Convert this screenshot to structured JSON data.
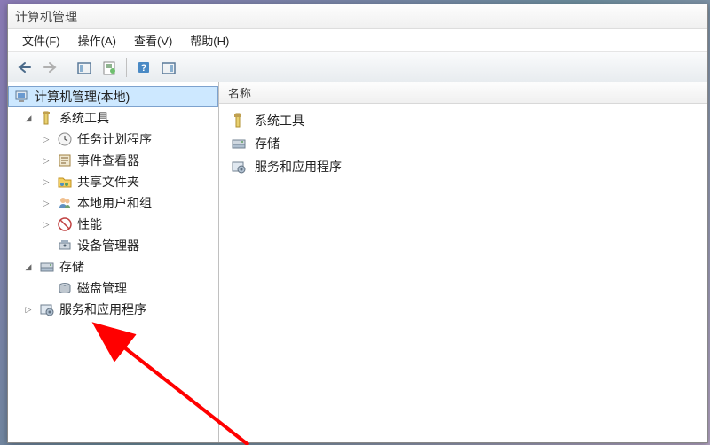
{
  "window": {
    "title": "计算机管理"
  },
  "menu": {
    "file": "文件(F)",
    "action": "操作(A)",
    "view": "查看(V)",
    "help": "帮助(H)"
  },
  "tree": {
    "root": "计算机管理(本地)",
    "system_tools": "系统工具",
    "task_scheduler": "任务计划程序",
    "event_viewer": "事件查看器",
    "shared_folders": "共享文件夹",
    "local_users": "本地用户和组",
    "performance": "性能",
    "device_manager": "设备管理器",
    "storage": "存储",
    "disk_management": "磁盘管理",
    "services_apps": "服务和应用程序"
  },
  "list": {
    "header_name": "名称",
    "items": {
      "system_tools": "系统工具",
      "storage": "存储",
      "services_apps": "服务和应用程序"
    }
  }
}
